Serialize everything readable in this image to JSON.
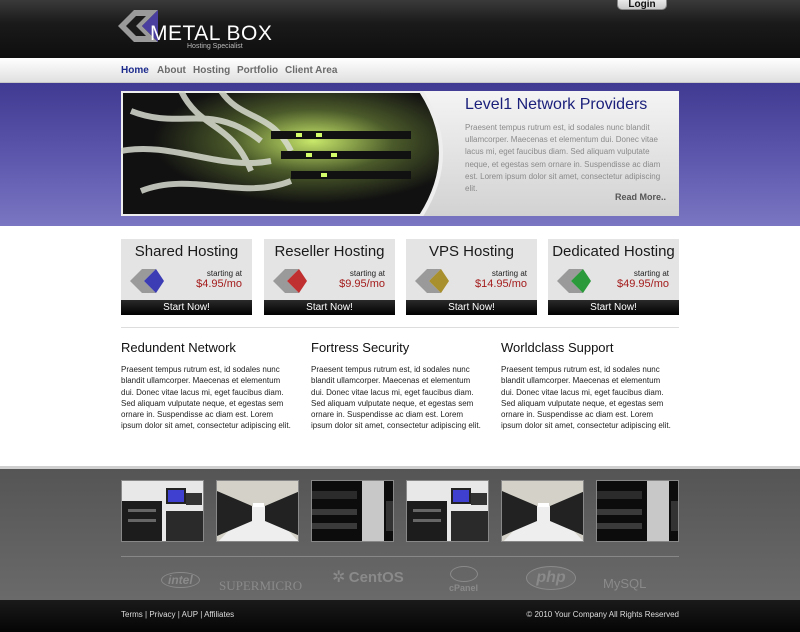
{
  "header": {
    "logo_text": "METAL BOX",
    "tagline": "Hosting Specialist",
    "login_label": "Login"
  },
  "nav": {
    "items": [
      "Home",
      "About",
      "Hosting",
      "Portfolio",
      "Client Area"
    ],
    "active": "Home"
  },
  "hero": {
    "title": "Level1 Network Providers",
    "text": "Praesent tempus rutrum est, id sodales nunc blandit ullamcorper. Maecenas et elementum dui. Donec vitae lacus mi, eget faucibus diam. Sed aliquam vulputate neque, et egestas sem ornare in. Suspendisse ac diam est. Lorem ipsum dolor sit amet, consectetur adipiscing elit.",
    "more_label": "Read More.."
  },
  "plans": [
    {
      "title": "Shared Hosting",
      "starting": "starting at",
      "price": "$4.95/mo",
      "button": "Start Now!",
      "color": "#3c3cb4"
    },
    {
      "title": "Reseller Hosting",
      "starting": "starting at",
      "price": "$9.95/mo",
      "button": "Start Now!",
      "color": "#c03030"
    },
    {
      "title": "VPS Hosting",
      "starting": "starting at",
      "price": "$14.95/mo",
      "button": "Start Now!",
      "color": "#a8902e"
    },
    {
      "title": "Dedicated Hosting",
      "starting": "starting at",
      "price": "$49.95/mo",
      "button": "Start Now!",
      "color": "#2a9a3a"
    }
  ],
  "features": [
    {
      "title": "Redundent Network",
      "text": "Praesent tempus rutrum est, id sodales nunc blandit ullamcorper. Maecenas et elementum dui. Donec vitae lacus mi, eget faucibus diam. Sed aliquam vulputate neque, et egestas sem ornare in. Suspendisse ac diam est. Lorem ipsum dolor sit amet, consectetur adipiscing elit."
    },
    {
      "title": "Fortress Security",
      "text": "Praesent tempus rutrum est, id sodales nunc blandit ullamcorper. Maecenas et elementum dui. Donec vitae lacus mi, eget faucibus diam. Sed aliquam vulputate neque, et egestas sem ornare in. Suspendisse ac diam est. Lorem ipsum dolor sit amet, consectetur adipiscing elit."
    },
    {
      "title": "Worldclass Support",
      "text": "Praesent tempus rutrum est, id sodales nunc blandit ullamcorper. Maecenas et elementum dui. Donec vitae lacus mi, eget faucibus diam. Sed aliquam vulputate neque, et egestas sem ornare in. Suspendisse ac diam est. Lorem ipsum dolor sit amet, consectetur adipiscing elit."
    }
  ],
  "partners": [
    "intel",
    "SUPERMICRO",
    "CentOS",
    "cPanel",
    "php",
    "MySQL"
  ],
  "footer": {
    "links": [
      "Terms",
      "Privacy",
      "AUP",
      "Affiliates"
    ],
    "copyright": "© 2010 Your Company All Rights Reserved"
  }
}
